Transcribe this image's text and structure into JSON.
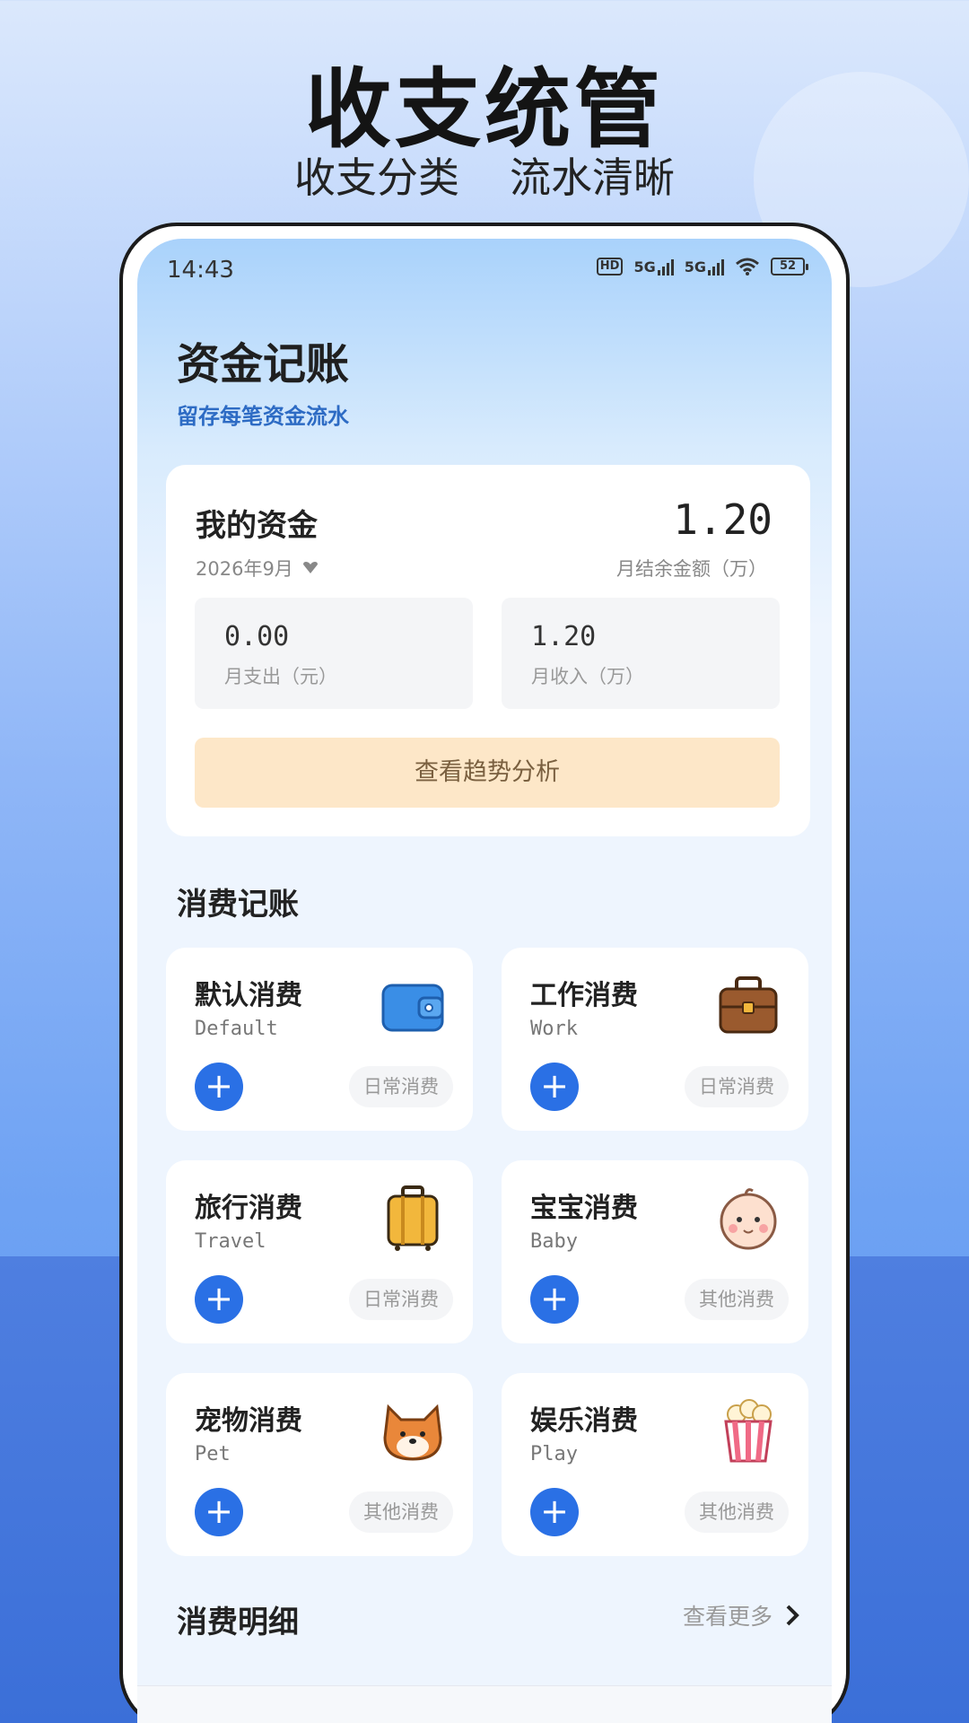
{
  "promo": {
    "title": "收支统管",
    "subtitle_left": "收支分类",
    "subtitle_right": "流水清晰"
  },
  "status_bar": {
    "time": "14:43",
    "hd": "HD",
    "net1": "5G",
    "net2": "5G",
    "battery": "52"
  },
  "header": {
    "title": "资金记账",
    "subtitle": "留存每笔资金流水"
  },
  "fund": {
    "label": "我的资金",
    "date": "2026年9月",
    "amount": "1.20",
    "amount_label": "月结余金额（万）",
    "expense_value": "0.00",
    "expense_label": "月支出（元）",
    "income_value": "1.20",
    "income_label": "月收入（万）",
    "trend_button": "查看趋势分析"
  },
  "section_consume": "消费记账",
  "categories": [
    {
      "name": "默认消费",
      "en": "Default",
      "tag": "日常消费",
      "icon": "wallet-icon"
    },
    {
      "name": "工作消费",
      "en": "Work",
      "tag": "日常消费",
      "icon": "briefcase-icon"
    },
    {
      "name": "旅行消费",
      "en": "Travel",
      "tag": "日常消费",
      "icon": "suitcase-icon"
    },
    {
      "name": "宝宝消费",
      "en": "Baby",
      "tag": "其他消费",
      "icon": "baby-icon"
    },
    {
      "name": "宠物消费",
      "en": "Pet",
      "tag": "其他消费",
      "icon": "dog-icon"
    },
    {
      "name": "娱乐消费",
      "en": "Play",
      "tag": "其他消费",
      "icon": "popcorn-icon"
    }
  ],
  "section_detail": "消费明细",
  "view_more": "查看更多",
  "colors": {
    "accent": "#2a70e5",
    "trend_button_bg": "#fde7c8"
  }
}
